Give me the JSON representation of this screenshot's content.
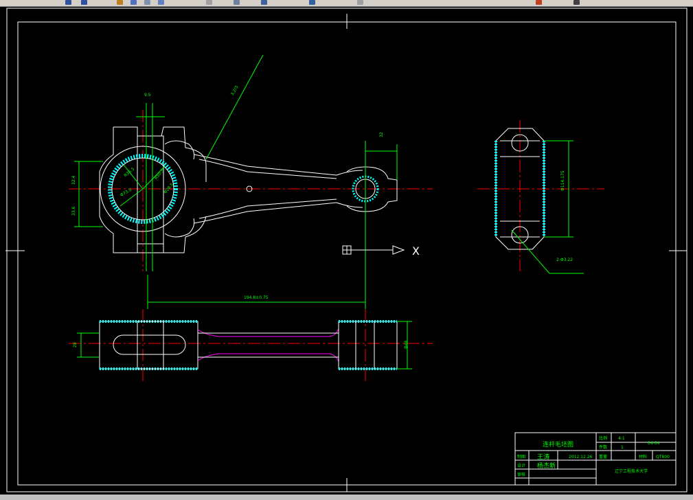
{
  "toolbar": {
    "icons": [
      "undo-icon",
      "redo-icon",
      "pan-icon",
      "zoom-icon",
      "zoom-window-icon",
      "zoom-previous-icon",
      "properties-icon",
      "text-style-icon",
      "layer-icon",
      "color-icon",
      "linetype-icon",
      "lineweight-icon",
      "plot-icon"
    ]
  },
  "colors": {
    "background": "#000000",
    "geometry": "#ffffff",
    "dimension": "#00ff00",
    "centerline": "#ff0000",
    "hatch": "#00ffff",
    "relief": "#ff00ff",
    "frame": "#ffffff"
  },
  "axis_icon": {
    "x_label": "X"
  },
  "dimensions": {
    "top_width": "9.5",
    "leader_text": "3.2/3",
    "height_upper": "32.4",
    "height_lower": "33.6",
    "r_inner": "R36.5",
    "r_outer": "R50.3",
    "phi_inner": "Φ73.0",
    "phi_outer": "Φ28.5",
    "small_end": "32",
    "center_distance": "194.8±0.75",
    "side_height": "Φ114.175",
    "hole_note": "2-Φ3.22",
    "thickness_left": "28",
    "thickness_right": "Φ48"
  },
  "title_block": {
    "part_name": "连杆毛坯图",
    "scale_label": "比例",
    "scale_value": "4:1",
    "quantity_label": "件数",
    "quantity_value": "1",
    "drawing_no": "04-04",
    "draw_label": "制图",
    "draw_name": "王涛",
    "draw_date": "2012.12.26",
    "weight_label": "重量",
    "material_label": "材料",
    "material_value": "QT800",
    "design_label": "设计",
    "design_name": "杨杰新",
    "audit_label": "审核",
    "school": "辽宁工程技术大学"
  }
}
